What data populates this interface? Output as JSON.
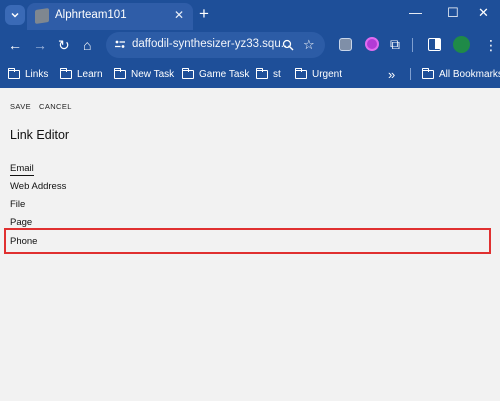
{
  "browser": {
    "tab_title": "Alphrteam101",
    "address": "daffodil-synthesizer-yz33.squ...",
    "bookmarks": [
      {
        "label": "Links"
      },
      {
        "label": "Learn"
      },
      {
        "label": "New Task"
      },
      {
        "label": "Game Task"
      },
      {
        "label": "st"
      },
      {
        "label": "Urgent"
      }
    ],
    "overflow_label": "»",
    "all_bookmarks": "All Bookmarks"
  },
  "editor": {
    "save_label": "SAVE",
    "cancel_label": "CANCEL",
    "title": "Link Editor",
    "options": [
      "Email",
      "Web Address",
      "File",
      "Page",
      "Phone"
    ],
    "selected_option": "Email",
    "highlighted_option": "Phone"
  },
  "colors": {
    "chrome": "#1e4f99",
    "highlight": "#e03030",
    "page_background": "#f2f2f2"
  }
}
